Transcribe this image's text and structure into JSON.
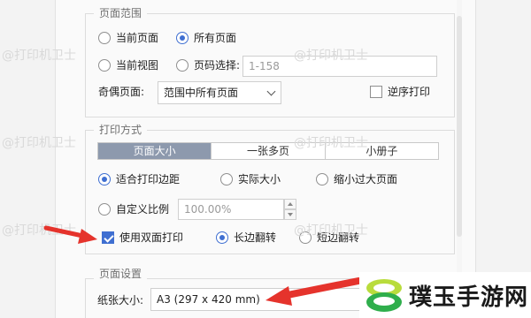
{
  "page_range": {
    "legend": "页面范围",
    "current_page": "当前页面",
    "all_pages": "所有页面",
    "current_view": "当前视图",
    "page_select": "页码选择:",
    "page_select_placeholder": "1-158",
    "odd_even_label": "奇偶页面:",
    "odd_even_value": "范围中所有页面",
    "reverse_order": "逆序打印"
  },
  "print_mode": {
    "legend": "打印方式",
    "tabs": [
      "页面大小",
      "一张多页",
      "小册子"
    ],
    "fit_margins": "适合打印边距",
    "actual_size": "实际大小",
    "shrink_large": "缩小过大页面",
    "custom_scale": "自定义比例",
    "scale_value": "100.00%",
    "duplex": "使用双面打印",
    "long_edge": "长边翻转",
    "short_edge": "短边翻转"
  },
  "page_setup": {
    "legend": "页面设置",
    "paper_size_label": "纸张大小:",
    "paper_size_value": "A3 (297 x 420 mm)"
  },
  "watermark": "@打印机卫士",
  "badge": {
    "text": "璞玉手游网",
    "icon": "leaf-logo-icon"
  },
  "colors": {
    "accent": "#3f6fd1",
    "tab_active": "#8d99ad",
    "arrow": "#e5332c"
  }
}
